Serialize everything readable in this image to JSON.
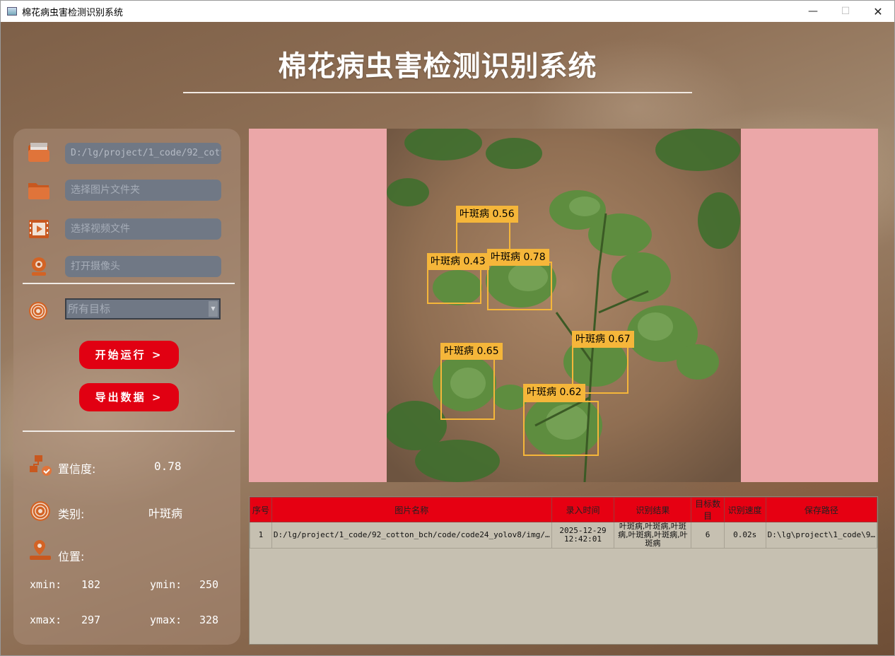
{
  "window": {
    "title": "棉花病虫害检测识别系统",
    "controls": [
      "—",
      "☐",
      "✕"
    ]
  },
  "header": {
    "title": "棉花病虫害检测识别系统"
  },
  "sources": {
    "image_path": "D:/lg/project/1_code/92_cotton_bch/code/code24_yolov8/img/",
    "folder_placeholder": "选择图片文件夹",
    "video_placeholder": "选择视频文件",
    "camera_placeholder": "打开摄像头"
  },
  "target_select": {
    "value": "所有目标"
  },
  "buttons": {
    "run": "开始运行 >",
    "export": "导出数据 >"
  },
  "info": {
    "confidence_label": "置信度:",
    "confidence_value": "0.78",
    "class_label": "类别:",
    "class_value": "叶斑病",
    "position_label": "位置:",
    "xmin_label": "xmin:",
    "xmin": "182",
    "ymin_label": "ymin:",
    "ymin": "250",
    "xmax_label": "xmax:",
    "xmax": "297",
    "ymax_label": "ymax:",
    "ymax": "328"
  },
  "detections": [
    {
      "label": "叶斑病 0.56"
    },
    {
      "label": "叶斑病 0.43"
    },
    {
      "label": "叶斑病 0.78"
    },
    {
      "label": "叶斑病 0.65"
    },
    {
      "label": "叶斑病 0.67"
    },
    {
      "label": "叶斑病 0.62"
    }
  ],
  "table": {
    "headers": [
      "序号",
      "图片名称",
      "录入时间",
      "识别结果",
      "目标数目",
      "识别速度",
      "保存路径"
    ],
    "rows": [
      [
        "1",
        "D:/lg/project/1_code/92_cotton_bch/code/code24_yolov8/img/…",
        "2025-12-29 12:42:01",
        "叶斑病,叶斑病,叶斑病,叶斑病,叶斑病,叶斑病",
        "6",
        "0.02s",
        "D:\\lg\\project\\1_code\\9…"
      ]
    ]
  },
  "colors": {
    "accent_red": "#e10012",
    "box_color": "#f5b63a",
    "display_bg": "#eba7a8"
  }
}
